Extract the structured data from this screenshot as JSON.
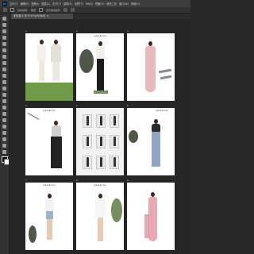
{
  "menu": {
    "logo": "Ps",
    "items": [
      "文件(F)",
      "编辑(E)",
      "图像(I)",
      "图层(L)",
      "文字(Y)",
      "选择(S)",
      "滤镜(T)",
      "3D(D)",
      "视图(V)",
      "增效工具",
      "窗口(W)",
      "帮助(H)"
    ]
  },
  "options": {
    "auto_select_label": "自动选择:",
    "layer_label": "图层",
    "transform_label": "显示变换控件"
  },
  "document": {
    "tab_title": "未标题-1 @ 8.33%(RGB/8) ×"
  },
  "artboards": {
    "labels": [
      "1",
      "2",
      "3",
      "4",
      "5",
      "6",
      "7",
      "8",
      "9"
    ],
    "brand_text": "grace & love"
  },
  "colors": {
    "background": "#282828",
    "panel": "#323232",
    "artboard": "#ffffff"
  }
}
